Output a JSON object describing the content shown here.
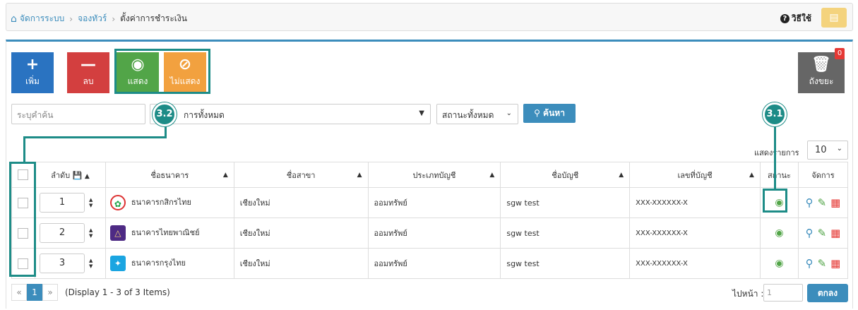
{
  "breadcrumb": {
    "home": "จัดการระบบ",
    "tour": "จองทัวร์",
    "current": "ตั้งค่าการชำระเงิน"
  },
  "help_label": "วิธีใช้",
  "toolbar": {
    "add": "เพิ่ม",
    "delete": "ลบ",
    "show": "แสดง",
    "hide": "ไม่แสดง",
    "trash": "ถังขยะ",
    "trash_count": "0"
  },
  "filters": {
    "search_placeholder": "ระบุคำค้น",
    "bank_filter": "การทั้งหมด",
    "status_filter": "สถานะทั้งหมด",
    "search_button": "ค้นหา"
  },
  "callouts": {
    "c31": "3.1",
    "c32": "3.2"
  },
  "page_size": {
    "label": "แสดงรายการ",
    "value": "10"
  },
  "columns": {
    "order": "ลำดับ",
    "bank": "ชื่อธนาคาร",
    "branch": "ชื่อสาขา",
    "type": "ประเภทบัญชี",
    "acc_name": "ชื่อบัญชี",
    "acc_no": "เลขที่บัญชี",
    "status": "สถานะ",
    "manage": "จัดการ"
  },
  "rows": [
    {
      "order": "1",
      "bank": "ธนาคารกสิกรไทย",
      "branch": "เชียงใหม่",
      "type": "ออมทรัพย์",
      "acc_name": "sgw test",
      "acc_no": "XXX-XXXXXX-X"
    },
    {
      "order": "2",
      "bank": "ธนาคารไทยพาณิชย์",
      "branch": "เชียงใหม่",
      "type": "ออมทรัพย์",
      "acc_name": "sgw test",
      "acc_no": "XXX-XXXXXX-X"
    },
    {
      "order": "3",
      "bank": "ธนาคารกรุงไทย",
      "branch": "เชียงใหม่",
      "type": "ออมทรัพย์",
      "acc_name": "sgw test",
      "acc_no": "XXX-XXXXXX-X"
    }
  ],
  "pager": {
    "prev": "«",
    "current": "1",
    "next": "»",
    "info": "(Display 1 - 3 of 3 Items)",
    "goto_label": "ไปหน้า :",
    "goto_value": "1",
    "ok": "ตกลง"
  },
  "colors": {
    "kasikorn": "#1ba345",
    "scb": "#4e2a84",
    "ktb": "#1ba5e1",
    "accent": "#1d8c87"
  }
}
